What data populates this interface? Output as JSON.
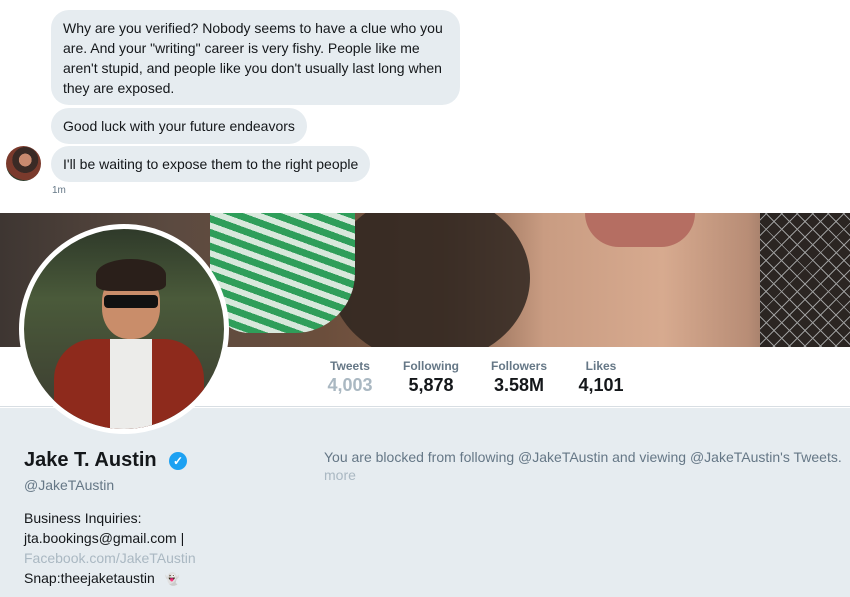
{
  "dm": {
    "messages": [
      "Why are you verified? Nobody seems to have a clue who you are. And your \"writing\" career is very fishy. People like me aren't stupid, and people like you don't usually last long when they are exposed.",
      "Good luck with your future endeavors",
      "I'll be waiting to expose them to the right people"
    ],
    "timestamp": "1m"
  },
  "profile": {
    "name": "Jake T. Austin",
    "verified_icon": "verified-badge-icon",
    "handle": "@JakeTAustin",
    "bio": {
      "line1": "Business Inquiries:",
      "line2": "jta.bookings@gmail.com |",
      "link": "Facebook.com/JakeTAustin",
      "line3": "Snap:theejaketaustin",
      "snap_icon": "snapchat-ghost-icon"
    },
    "stats": {
      "tweets": {
        "label": "Tweets",
        "value": "4,003"
      },
      "following": {
        "label": "Following",
        "value": "5,878"
      },
      "followers": {
        "label": "Followers",
        "value": "3.58M"
      },
      "likes": {
        "label": "Likes",
        "value": "4,101"
      }
    },
    "blocked_message": "You are blocked from following @JakeTAustin and viewing @JakeTAustin's Tweets.",
    "more_link": "more"
  },
  "colors": {
    "bubble": "#e6ecf0",
    "verified": "#1da1f2",
    "muted_text": "#657786",
    "light_text": "#aab8c2",
    "page_bg": "#e6ecf0"
  }
}
